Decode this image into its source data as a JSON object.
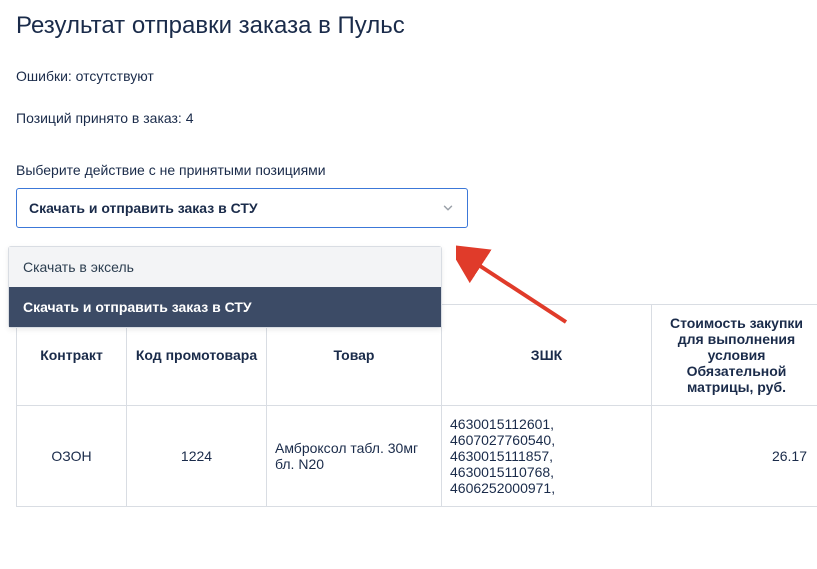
{
  "title": "Результат отправки заказа в Пульс",
  "errors_line": "Ошибки: отсутствуют",
  "accepted_line": "Позиций принято в заказ: 4",
  "select": {
    "label": "Выберите действие с не принятыми позициями",
    "value": "Скачать и отправить заказ в СТУ",
    "options": [
      "Скачать в эксель",
      "Скачать и отправить заказ в СТУ"
    ]
  },
  "table": {
    "headers": [
      "Контракт",
      "Код промотовара",
      "Товар",
      "ЗШК",
      "Стоимость закупки для выполнения условия Обязательной матрицы, руб."
    ],
    "rows": [
      {
        "contract": "ОЗОН",
        "promo_code": "1224",
        "product": "Амброксол табл. 30мг бл. N20",
        "zshk": "4630015112601, 4607027760540, 4630015111857, 4630015110768, 4606252000971,",
        "cost": "26.17"
      }
    ]
  }
}
